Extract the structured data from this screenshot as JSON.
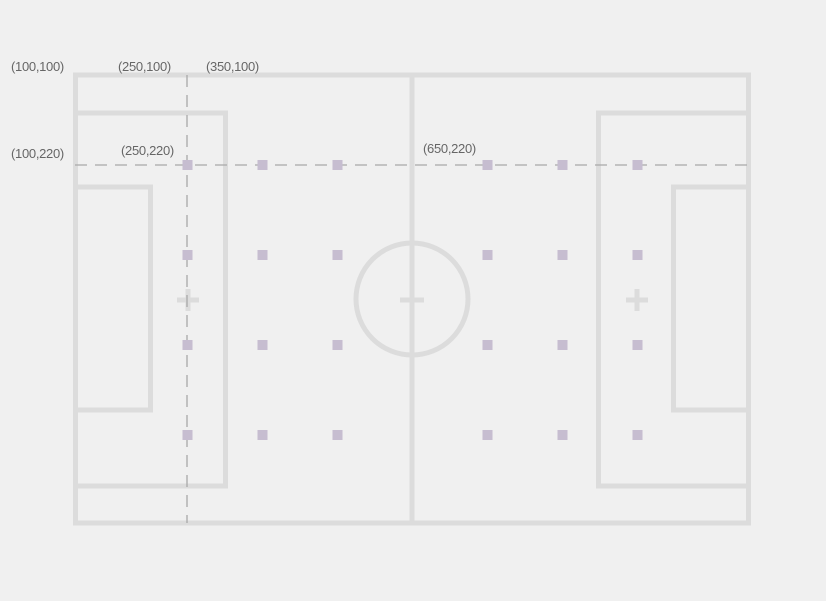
{
  "colors": {
    "background": "#f0f0f0",
    "field_lines": "#dcdcdc",
    "guide_lines": "#a8a8a8",
    "grid_markers": "#c6bdd0",
    "label_text": "#666666"
  },
  "coordinate_labels": [
    {
      "id": "c-100-100",
      "text": "(100,100)"
    },
    {
      "id": "c-250-100",
      "text": "(250,100)"
    },
    {
      "id": "c-350-100",
      "text": "(350,100)"
    },
    {
      "id": "c-100-220",
      "text": "(100,220)"
    },
    {
      "id": "c-250-220",
      "text": "(250,220)"
    },
    {
      "id": "c-650-220",
      "text": "(650,220)"
    }
  ],
  "marker_grid": {
    "columns": [
      250,
      350,
      450,
      650,
      750,
      850
    ],
    "rows": [
      220,
      340,
      460,
      580
    ],
    "marker_icon": "square-marker-icon"
  },
  "field_icons": [
    "left-penalty-spot-icon",
    "center-spot-icon",
    "right-penalty-spot-icon"
  ]
}
